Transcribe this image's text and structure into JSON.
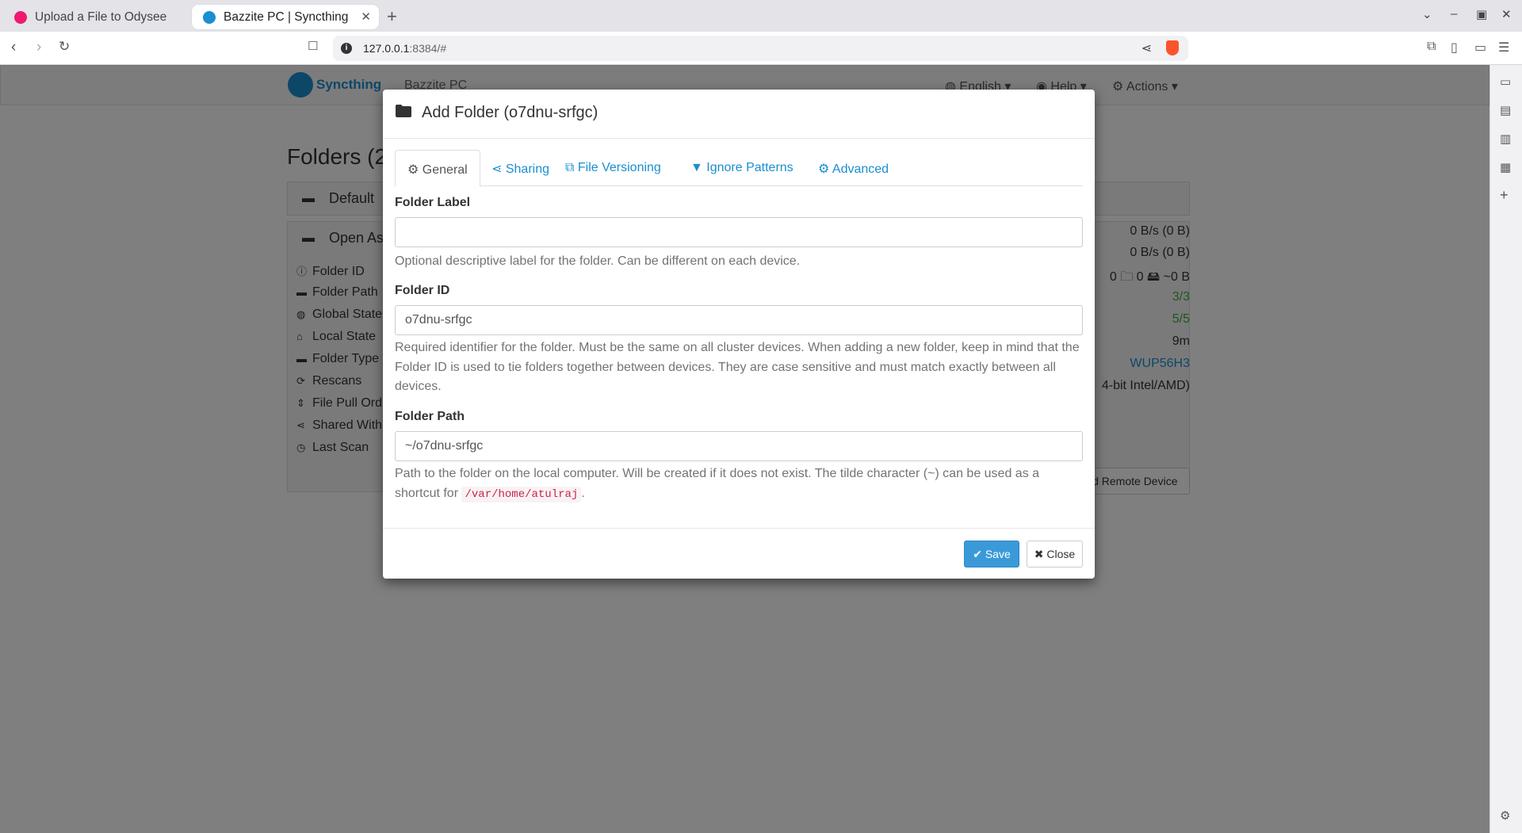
{
  "browser": {
    "tabs": [
      {
        "title": "Upload a File to Odysee"
      },
      {
        "title": "Bazzite PC | Syncthing"
      }
    ],
    "url_host": "127.0.0.1",
    "url_rest": ":8384/#"
  },
  "app": {
    "brand": "Syncthing",
    "device_name": "Bazzite PC",
    "menu": {
      "language": "English",
      "help": "Help",
      "actions": "Actions"
    },
    "folders_title": "Folders (2",
    "folder_default": "Default",
    "folder_open": "Open As",
    "details": [
      {
        "label": "Folder ID",
        "icon": "info-icon"
      },
      {
        "label": "Folder Path",
        "icon": "folder-open-icon"
      },
      {
        "label": "Global State",
        "icon": "globe-icon"
      },
      {
        "label": "Local State",
        "icon": "home-icon"
      },
      {
        "label": "Folder Type",
        "icon": "folder-icon"
      },
      {
        "label": "Rescans",
        "icon": "refresh-icon"
      },
      {
        "label": "File Pull Ord",
        "icon": "sort-icon"
      },
      {
        "label": "Shared With",
        "icon": "share-icon"
      },
      {
        "label": "Last Scan",
        "icon": "clock-icon"
      }
    ],
    "right_values": [
      "0 B/s (0 B)",
      "0 B/s (0 B)",
      "0 🗀 0 🖴 ~0 B",
      "3/3",
      "5/5",
      "9m",
      "WUP56H3",
      "4-bit Intel/AMD)"
    ],
    "remote_device_button": "ld Remote Device"
  },
  "modal": {
    "title": "Add Folder (o7dnu-srfgc)",
    "tabs": [
      "General",
      "Sharing",
      "File Versioning",
      "Ignore Patterns",
      "Advanced"
    ],
    "folder_label": {
      "label": "Folder Label",
      "value": "",
      "help": "Optional descriptive label for the folder. Can be different on each device."
    },
    "folder_id": {
      "label": "Folder ID",
      "value": "o7dnu-srfgc",
      "help": "Required identifier for the folder. Must be the same on all cluster devices. When adding a new folder, keep in mind that the Folder ID is used to tie folders together between devices. They are case sensitive and must match exactly between all devices."
    },
    "folder_path": {
      "label": "Folder Path",
      "value": "~/o7dnu-srfgc",
      "help_before": "Path to the folder on the local computer. Will be created if it does not exist. The tilde character (~) can be used as a shortcut for",
      "help_code": "/var/home/atulraj",
      "help_after": "."
    },
    "save_label": "Save",
    "close_label": "Close"
  },
  "colors": {
    "accent": "#1a8ed0",
    "save": "#3a9ad9",
    "green": "#3cae3c",
    "code": "#c7254e"
  }
}
